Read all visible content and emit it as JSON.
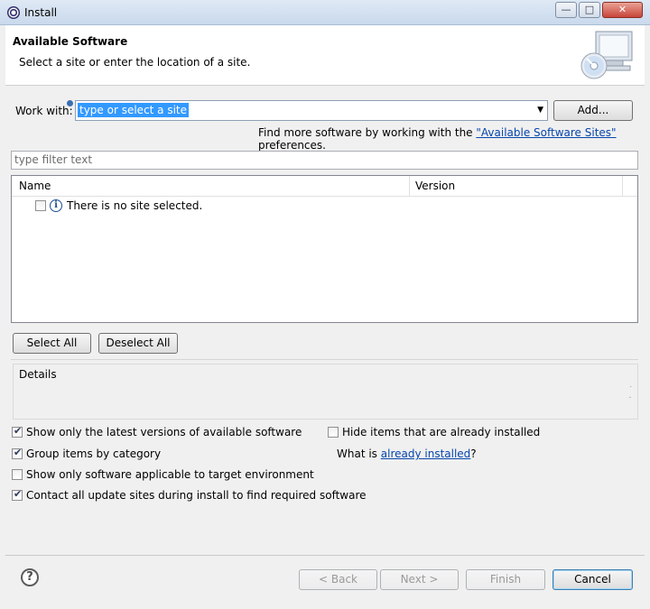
{
  "window": {
    "title": "Install",
    "controls": {
      "minimize": "—",
      "maximize": "□",
      "close": "✕"
    }
  },
  "header": {
    "title": "Available Software",
    "subtitle": "Select a site or enter the location of a site."
  },
  "work_with": {
    "label": "Work with:",
    "value": "type or select a site",
    "add_button": "Add...",
    "hint_prefix": "Find more software by working with the ",
    "hint_link": "\"Available Software Sites\"",
    "hint_suffix": " preferences."
  },
  "filter": {
    "placeholder": "type filter text"
  },
  "table": {
    "columns": [
      "Name",
      "Version"
    ],
    "rows": [
      {
        "checked": false,
        "icon": "info-icon",
        "text": "There is no site selected."
      }
    ]
  },
  "selection_buttons": {
    "select_all": "Select All",
    "deselect_all": "Deselect All"
  },
  "details": {
    "label": "Details"
  },
  "options": {
    "latest_versions": {
      "label": "Show only the latest versions of available software",
      "checked": true
    },
    "group_by_category": {
      "label": "Group items by category",
      "checked": true
    },
    "applicable_only": {
      "label": "Show only software applicable to target environment",
      "checked": false
    },
    "contact_sites": {
      "label": "Contact all update sites during install to find required software",
      "checked": true
    },
    "hide_installed": {
      "label": "Hide items that are already installed",
      "checked": false
    },
    "what_is_prefix": "What is ",
    "what_is_link": "already installed",
    "what_is_suffix": "?"
  },
  "footer": {
    "help": "?",
    "back": "< Back",
    "next": "Next >",
    "finish": "Finish",
    "cancel": "Cancel"
  }
}
